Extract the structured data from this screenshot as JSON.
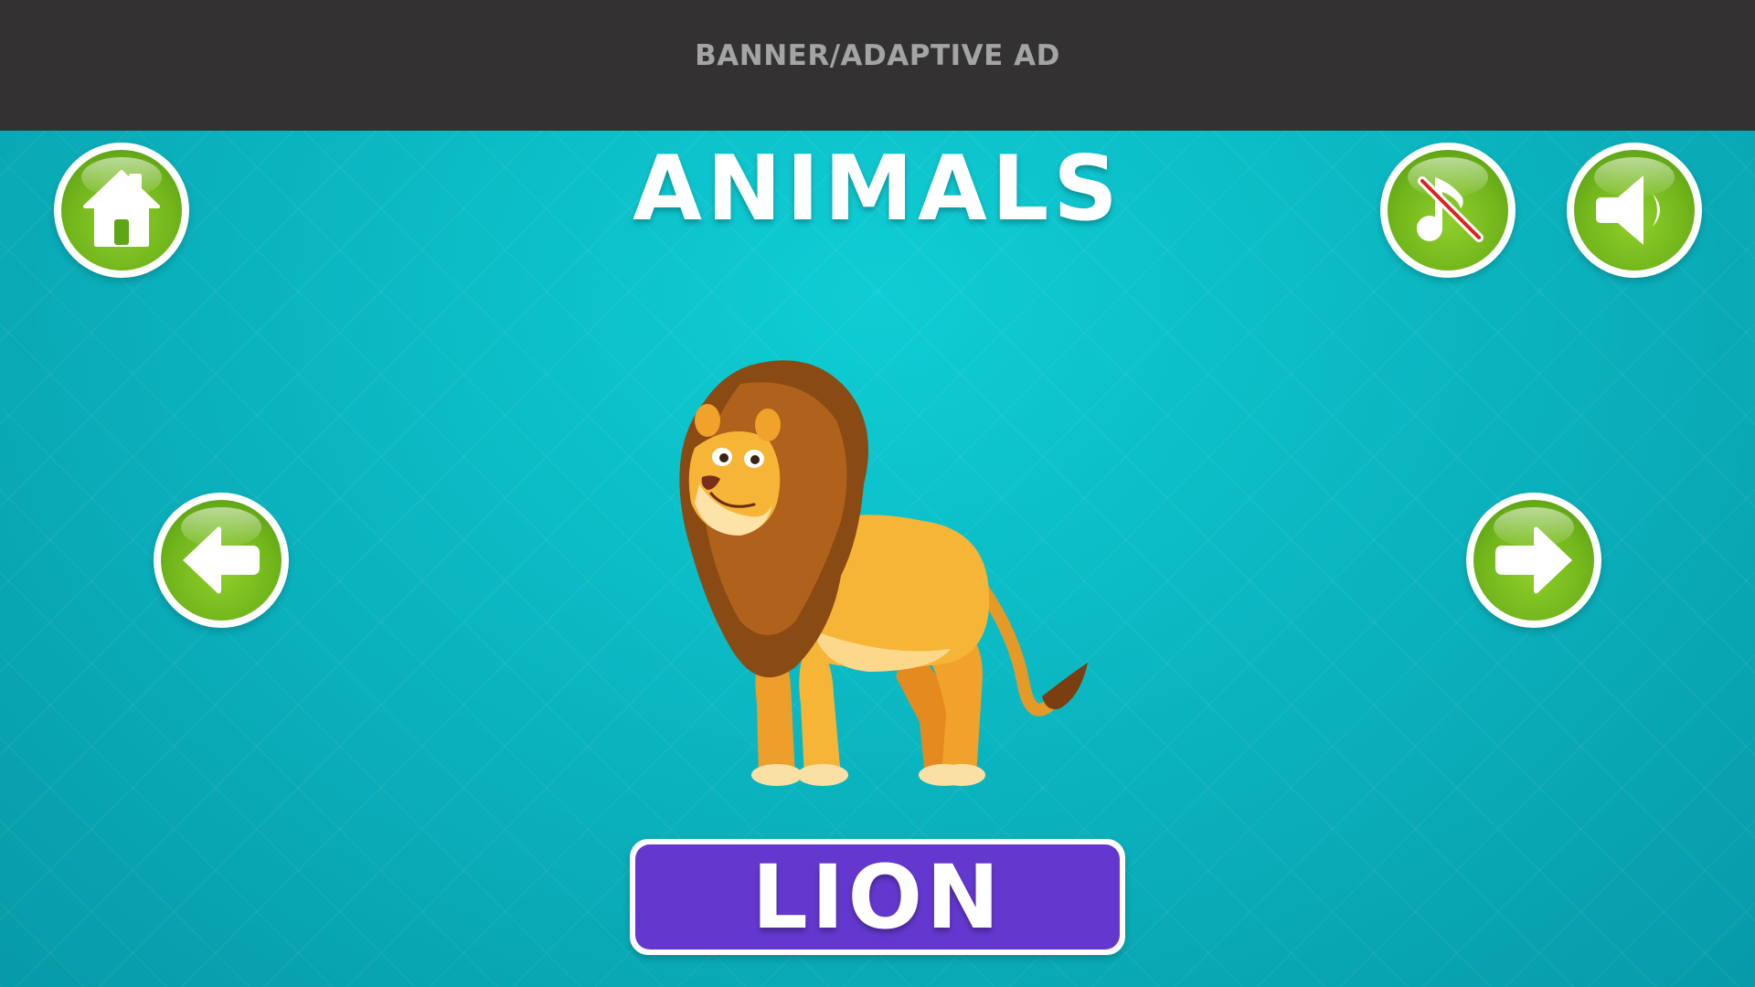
{
  "ad_banner": {
    "label": "BANNER/ADAPTIVE AD"
  },
  "header": {
    "title": "ANIMALS"
  },
  "buttons": {
    "home": {
      "icon": "home-icon"
    },
    "music": {
      "icon": "music-off-icon",
      "state": "muted"
    },
    "sound": {
      "icon": "speaker-icon"
    },
    "previous": {
      "icon": "arrow-left-icon"
    },
    "next": {
      "icon": "arrow-right-icon"
    }
  },
  "card": {
    "image": "lion-illustration",
    "name": "LION"
  },
  "colors": {
    "background": "#0bb9c3",
    "button_green": "#72b61c",
    "name_plate": "#6438cf",
    "ad_banner": "#333131"
  }
}
